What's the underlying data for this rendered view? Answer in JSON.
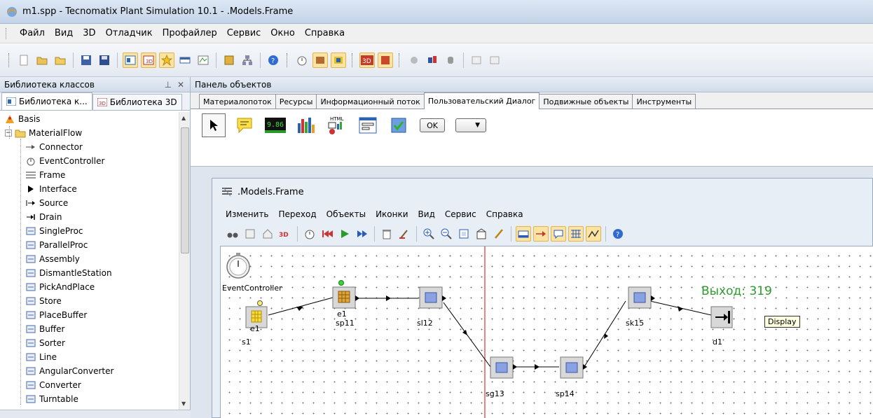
{
  "window": {
    "title": "m1.spp - Tecnomatix Plant Simulation 10.1 - .Models.Frame"
  },
  "menubar": {
    "items": [
      "Файл",
      "Вид",
      "3D",
      "Отладчик",
      "Профайлер",
      "Сервис",
      "Окно",
      "Справка"
    ]
  },
  "class_library": {
    "header": "Библиотека классов",
    "tabs": [
      "Библиотека к...",
      "Библиотека 3D"
    ],
    "root": "Basis",
    "folder": "MaterialFlow",
    "items": [
      "Connector",
      "EventController",
      "Frame",
      "Interface",
      "Source",
      "Drain",
      "SingleProc",
      "ParallelProc",
      "Assembly",
      "DismantleStation",
      "PickAndPlace",
      "Store",
      "PlaceBuffer",
      "Buffer",
      "Sorter",
      "Line",
      "AngularConverter",
      "Converter",
      "Turntable"
    ]
  },
  "object_panel": {
    "header": "Панель объектов",
    "tabs": [
      "Материалопоток",
      "Ресурсы",
      "Информационный поток",
      "Пользовательский Диалог",
      "Подвижные объекты",
      "Инструменты"
    ],
    "active_tab": "Пользовательский Диалог",
    "ok_label": "OK",
    "counter_label": "9.86",
    "html_label": "HTML"
  },
  "frame_window": {
    "title": ".Models.Frame",
    "menu": [
      "Изменить",
      "Переход",
      "Объекты",
      "Иконки",
      "Вид",
      "Сервис",
      "Справка"
    ],
    "objects": {
      "event_controller": "EventController",
      "s1": "s1",
      "e1a": "e1",
      "e1b": "e1",
      "sp11": "sp11",
      "sl12": "sl12",
      "sg13": "sg13",
      "sp14": "sp14",
      "sk15": "sk15",
      "d1": "d1"
    },
    "display": {
      "label": "Выход:",
      "value": "319"
    },
    "tooltip": "Display"
  }
}
